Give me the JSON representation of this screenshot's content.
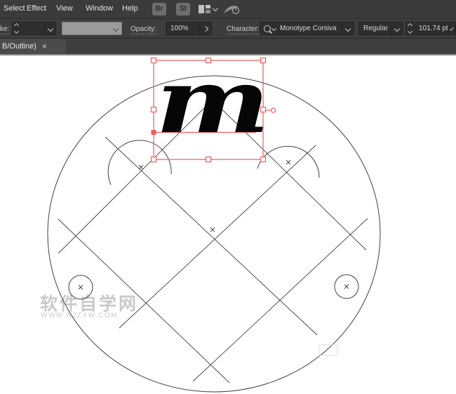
{
  "menu_bar": {
    "items": [
      "Select",
      "Effect",
      "View",
      "Window",
      "Help"
    ],
    "bridge_button": "Br",
    "stock_button": "St"
  },
  "control_bar": {
    "stroke_label": "ke:",
    "opacity_label": "Opacity:",
    "opacity_value": "100%",
    "character_label": "Character:",
    "font_family": "Monotype Corsiva",
    "font_style": "Regular",
    "font_size": "101.74 pt"
  },
  "tab_bar": {
    "title": "B/Outline)",
    "close_glyph": "×"
  },
  "canvas": {
    "letter": "m",
    "watermark_title": "软件自学网",
    "watermark_url": "WWW.RJZXW.COM"
  },
  "colors": {
    "selection_red": "#f15b5b",
    "artwork_line": "#3f3f3f",
    "ui_dark": "#3b3b3b"
  }
}
